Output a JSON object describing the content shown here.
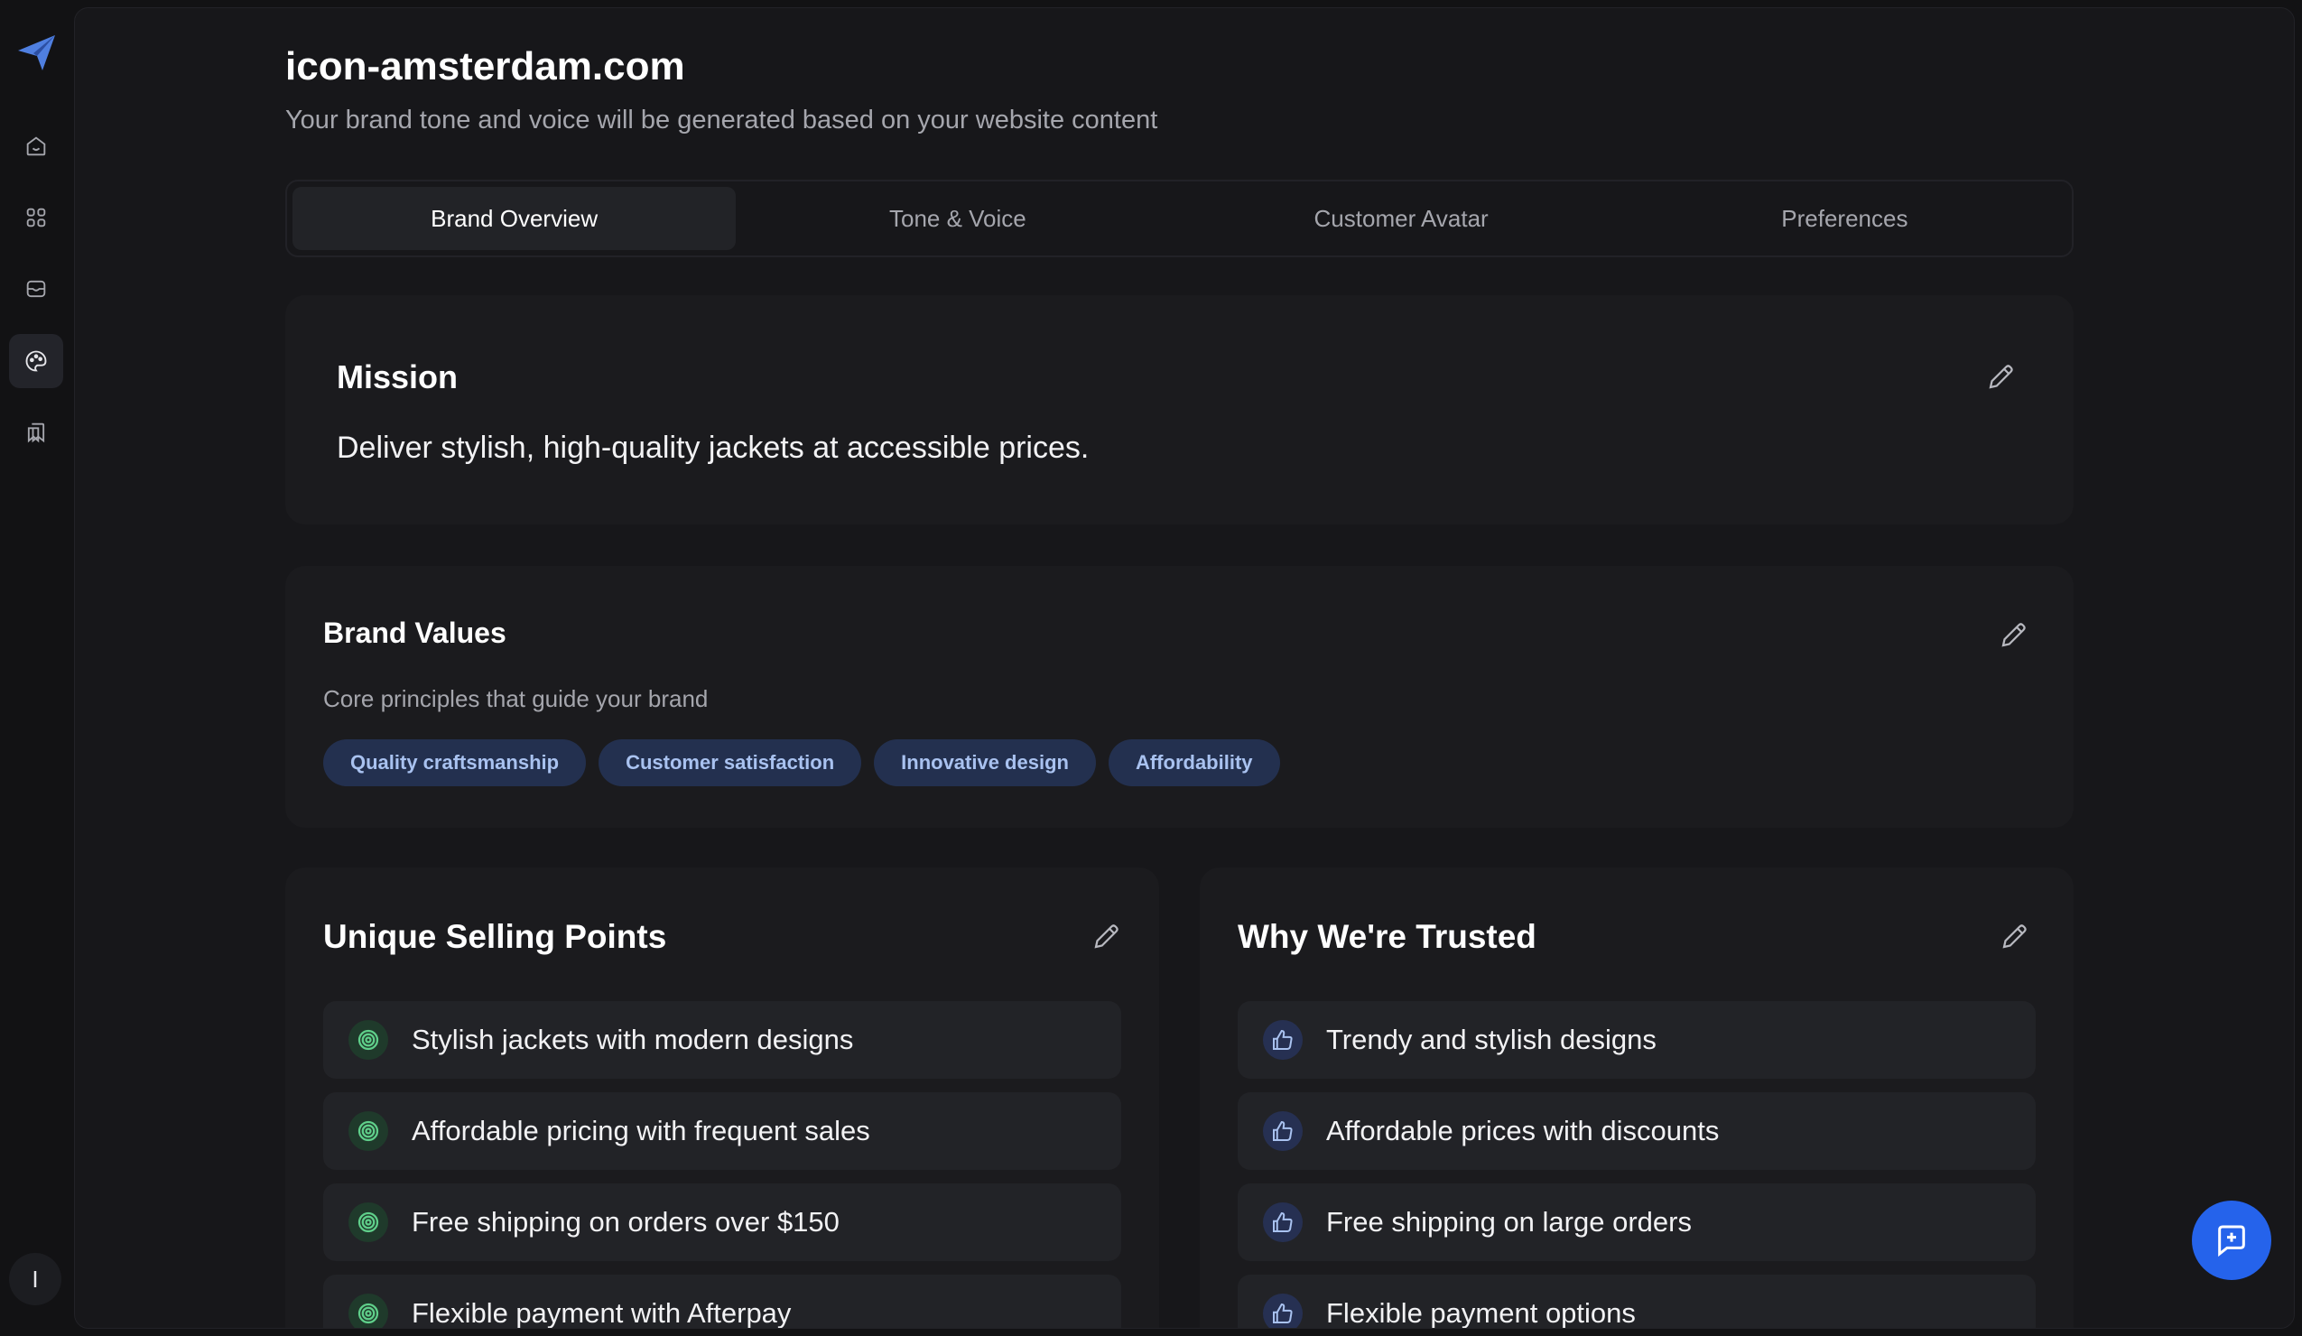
{
  "app": {
    "logo_icon": "paper-plane-icon",
    "accent_color": "#4f7fe0"
  },
  "sidebar": {
    "items": [
      {
        "name": "home",
        "icon": "home-icon"
      },
      {
        "name": "apps",
        "icon": "grid-icon"
      },
      {
        "name": "inbox",
        "icon": "mail-icon"
      },
      {
        "name": "brand",
        "icon": "palette-icon",
        "active": true
      },
      {
        "name": "library",
        "icon": "bookmarks-icon"
      }
    ],
    "avatar_initial": "I"
  },
  "header": {
    "title": "icon-amsterdam.com",
    "subtitle": "Your brand tone and voice will be generated based on your website content"
  },
  "tabs": [
    {
      "label": "Brand Overview",
      "active": true
    },
    {
      "label": "Tone & Voice",
      "active": false
    },
    {
      "label": "Customer Avatar",
      "active": false
    },
    {
      "label": "Preferences",
      "active": false
    }
  ],
  "mission": {
    "title": "Mission",
    "text": "Deliver stylish, high-quality jackets at accessible prices."
  },
  "brand_values": {
    "title": "Brand Values",
    "subtitle": "Core principles that guide your brand",
    "values": [
      "Quality craftsmanship",
      "Customer satisfaction",
      "Innovative design",
      "Affordability"
    ]
  },
  "usp": {
    "title": "Unique Selling Points",
    "icon": "target-icon",
    "items": [
      "Stylish jackets with modern designs",
      "Affordable pricing with frequent sales",
      "Free shipping on orders over $150",
      "Flexible payment with Afterpay"
    ]
  },
  "trusted": {
    "title": "Why We're Trusted",
    "icon": "thumbs-up-icon",
    "items": [
      "Trendy and stylish designs",
      "Affordable prices with discounts",
      "Free shipping on large orders",
      "Flexible payment options"
    ]
  },
  "chat_button": {
    "icon": "chat-plus-icon"
  }
}
